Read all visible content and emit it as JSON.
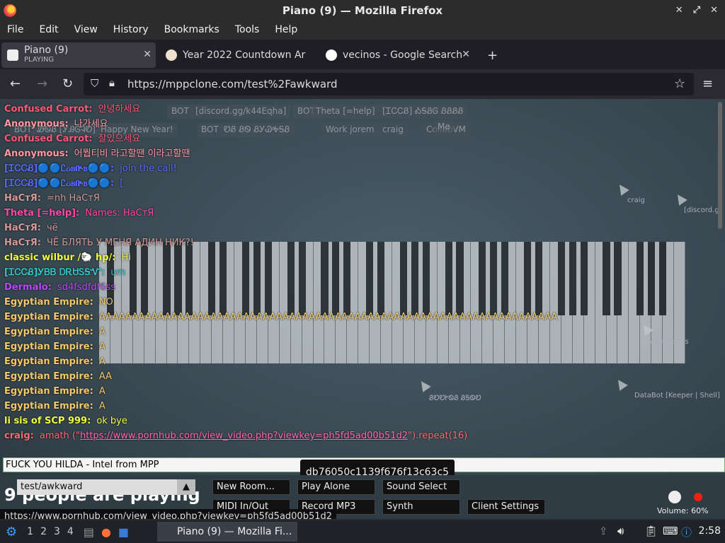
{
  "window": {
    "title": "Piano (9) — Mozilla Firefox"
  },
  "menu": [
    "File",
    "Edit",
    "View",
    "History",
    "Bookmarks",
    "Tools",
    "Help"
  ],
  "tabs": [
    {
      "label": "Piano (9)",
      "sublabel": "PLAYING"
    },
    {
      "label": "Year 2022 Countdown Ar"
    },
    {
      "label": "vecinos - Google Search"
    }
  ],
  "url": "https://mppclone.com/test%2Fawkward",
  "chat": [
    {
      "name": "Confused Carrot:",
      "text": "안녕하세요",
      "color": "#ff5a78"
    },
    {
      "name": "Anonymous:",
      "text": "나가세요",
      "color": "#ff9aa5"
    },
    {
      "name": "Confused Carrot:",
      "text": "잘있으세요",
      "color": "#ff5a78"
    },
    {
      "name": "Anonymous:",
      "text": "어뭡티비 라고할땐 이라고할땐",
      "color": "#ff9aa5"
    },
    {
      "name": "[ᏆᏟᏟᏰ]🔵🔵Ꮭᏽᏼᎅᏼ🔵🔵:",
      "text": "join the call!",
      "color": "#5a6bff"
    },
    {
      "name": "[ᏆᏟᏟᏰ]🔵🔵Ꮭᏽᏼᎅᏼ🔵🔵:",
      "text": "[",
      "color": "#5a6bff"
    },
    {
      "name": "НаСтЯ:",
      "text": "=nh НаСтЯ",
      "color": "#d79a9a"
    },
    {
      "name": "Theta [=help]:",
      "text": "Names: НаСтЯ",
      "color": "#ff4aa8"
    },
    {
      "name": "НаСтЯ:",
      "text": "чё",
      "color": "#d79a9a"
    },
    {
      "name": "НаСтЯ:",
      "text": "ЧЁ БЛЯТЬ У МЕНЯ АДИН НИК?!",
      "color": "#d79a9a"
    },
    {
      "name": "classic wilbur /🐑 hp/:",
      "text": "Hi",
      "color": "#f0ff40"
    },
    {
      "name": "[ᏆᏟᏟᏰ]ᎩᏴᏴ ᎠᎡᏌᏚᎦᏉ:",
      "text": "um",
      "color": "#39c6c6"
    },
    {
      "name": "Dermalo:",
      "text": "sd4fsdfdf6ss",
      "color": "#b64aff"
    },
    {
      "name": "Egyptian Empire:",
      "text": "NO",
      "color": "#f5c86a"
    },
    {
      "name": "Egyptian Empire:",
      "text": "AAAAAAAAAAAAAAAAAAAAAAAAAAAAAAAAAAAAAAAAAAAAAAAAAAAAAAAAAAAAAAAAAAAAAA",
      "color": "#f5c86a"
    },
    {
      "name": "Egyptian Empire:",
      "text": "A",
      "color": "#f5c86a"
    },
    {
      "name": "Egyptian Empire:",
      "text": "A",
      "color": "#f5c86a"
    },
    {
      "name": "Egyptian Empire:",
      "text": "A",
      "color": "#f5c86a"
    },
    {
      "name": "Egyptian Empire:",
      "text": "AA",
      "color": "#f5c86a"
    },
    {
      "name": "Egyptian Empire:",
      "text": "A",
      "color": "#f5c86a"
    },
    {
      "name": "Egyptian Empire:",
      "text": "A",
      "color": "#f5c86a"
    },
    {
      "name": "li sis of SCP 999:",
      "text": "ok bye",
      "color": "#f0ff40"
    }
  ],
  "last_msg": {
    "name": "craig:",
    "pre": "amath (\"",
    "link": "https://www.pornhub.com/view_video.php?viewkey=ph5fd5ad00b51d2",
    "post": "\").repeat(16)",
    "color": "#ff6b7a"
  },
  "chat_input": "FUCK YOU HILDA - Intel from MPP",
  "tooltip": "db76050c1139f676f13c63c5",
  "room_name": "test/awkward",
  "big_text": "9 people are playing",
  "buttons": {
    "new_room": "New Room...",
    "play_alone": "Play Alone",
    "sound_select": "Sound Select",
    "midi": "MIDI In/Out",
    "record": "Record MP3",
    "synth": "Synth",
    "client_settings": "Client Settings"
  },
  "volume": "Volume: 60%",
  "status_url": "https://www.pornhub.com/view_video.php?viewkey=ph5fd5ad00b51d2",
  "background_chips": [
    "BOT",
    "[discord.gg/k44Eqha]",
    "BOT",
    "Theta [=help]",
    "[ᏆᏟᏟᏰ] ᎣᎦᏰᎶ ᏰᏰᏰᏰ",
    "BOT",
    "ᏪᏫᏰ [ᎩᎯᎶᎸᏬ]",
    "Happy New Year!",
    "BOT",
    "ᏬᏰ ᏰᏫ ᏰᎩᏊᎭᎦᏰ",
    "Work jorem",
    "craig",
    "CollabVM",
    "Me"
  ],
  "cursor_labels": [
    "craig",
    "[discord.g",
    "Wy Pikeaus",
    "ᏰᏬᏬᎨᏫᏰ ᏰᎦᏫᏬ",
    "DataBot [Keeper | Shell]"
  ],
  "taskbar": {
    "workspaces": [
      "1",
      "2",
      "3",
      "4"
    ],
    "app": "Piano (9) — Mozilla Fi...",
    "clock": "2:58"
  }
}
